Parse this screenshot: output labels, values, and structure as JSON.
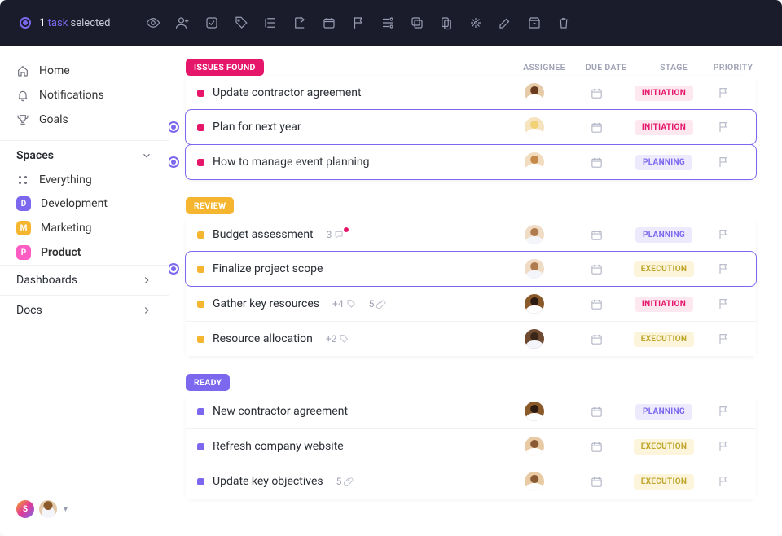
{
  "topbar": {
    "count": "1",
    "task_word": "task",
    "selected_word": "selected",
    "icons": [
      "eye",
      "user-add",
      "checkbox",
      "tag",
      "indent",
      "move",
      "calendar",
      "flag",
      "list-set",
      "copy",
      "duplicate",
      "dependencies",
      "edit",
      "archive",
      "trash"
    ]
  },
  "sidebar": {
    "nav": [
      {
        "icon": "home",
        "label": "Home"
      },
      {
        "icon": "bell",
        "label": "Notifications"
      },
      {
        "icon": "trophy",
        "label": "Goals"
      }
    ],
    "spaces_label": "Spaces",
    "everything_label": "Everything",
    "spaces": [
      {
        "letter": "D",
        "color": "#7b68ee",
        "label": "Development",
        "bold": false
      },
      {
        "letter": "M",
        "color": "#f5b52e",
        "label": "Marketing",
        "bold": false
      },
      {
        "letter": "P",
        "color": "#ff5cc4",
        "label": "Product",
        "bold": true
      }
    ],
    "dashboards": "Dashboards",
    "docs": "Docs",
    "user_letter": "S"
  },
  "columns": {
    "assignee": "ASSIGNEE",
    "due": "DUE DATE",
    "stage": "STAGE",
    "priority": "PRIORITY"
  },
  "groups": [
    {
      "status": "ISSUES FOUND",
      "status_color": "#e6176b",
      "dot": "#e6176b",
      "tasks": [
        {
          "title": "Update contractor agreement",
          "avatar": "av1",
          "stage": "INITIATION",
          "stage_cls": "stg-initiation",
          "selected": false
        },
        {
          "title": "Plan for next year",
          "avatar": "av2",
          "stage": "INITIATION",
          "stage_cls": "stg-initiation",
          "selected": true
        },
        {
          "title": "How to manage event planning",
          "avatar": "av3",
          "stage": "PLANNING",
          "stage_cls": "stg-planning",
          "selected": true
        }
      ]
    },
    {
      "status": "REVIEW",
      "status_color": "#f5b52e",
      "dot": "#f5b52e",
      "tasks": [
        {
          "title": "Budget assessment",
          "avatar": "av4",
          "stage": "PLANNING",
          "stage_cls": "stg-planning",
          "selected": false,
          "meta": [
            {
              "t": "3",
              "i": "chat",
              "pink": true
            }
          ]
        },
        {
          "title": "Finalize project scope",
          "avatar": "av4",
          "stage": "EXECUTION",
          "stage_cls": "stg-execution",
          "selected": true
        },
        {
          "title": "Gather key resources",
          "avatar": "av5",
          "stage": "INITIATION",
          "stage_cls": "stg-initiation",
          "selected": false,
          "meta": [
            {
              "t": "+4",
              "i": "tag"
            },
            {
              "t": "5",
              "i": "clip"
            }
          ]
        },
        {
          "title": "Resource allocation",
          "avatar": "av6",
          "stage": "EXECUTION",
          "stage_cls": "stg-execution",
          "selected": false,
          "meta": [
            {
              "t": "+2",
              "i": "tag"
            }
          ]
        }
      ]
    },
    {
      "status": "READY",
      "status_color": "#7b68ee",
      "dot": "#7b68ee",
      "tasks": [
        {
          "title": "New contractor agreement",
          "avatar": "av5",
          "stage": "PLANNING",
          "stage_cls": "stg-planning",
          "selected": false
        },
        {
          "title": "Refresh company website",
          "avatar": "av7",
          "stage": "EXECUTION",
          "stage_cls": "stg-execution",
          "selected": false
        },
        {
          "title": "Update key objectives",
          "avatar": "av7",
          "stage": "EXECUTION",
          "stage_cls": "stg-execution",
          "selected": false,
          "meta": [
            {
              "t": "5",
              "i": "clip"
            }
          ]
        }
      ]
    }
  ]
}
